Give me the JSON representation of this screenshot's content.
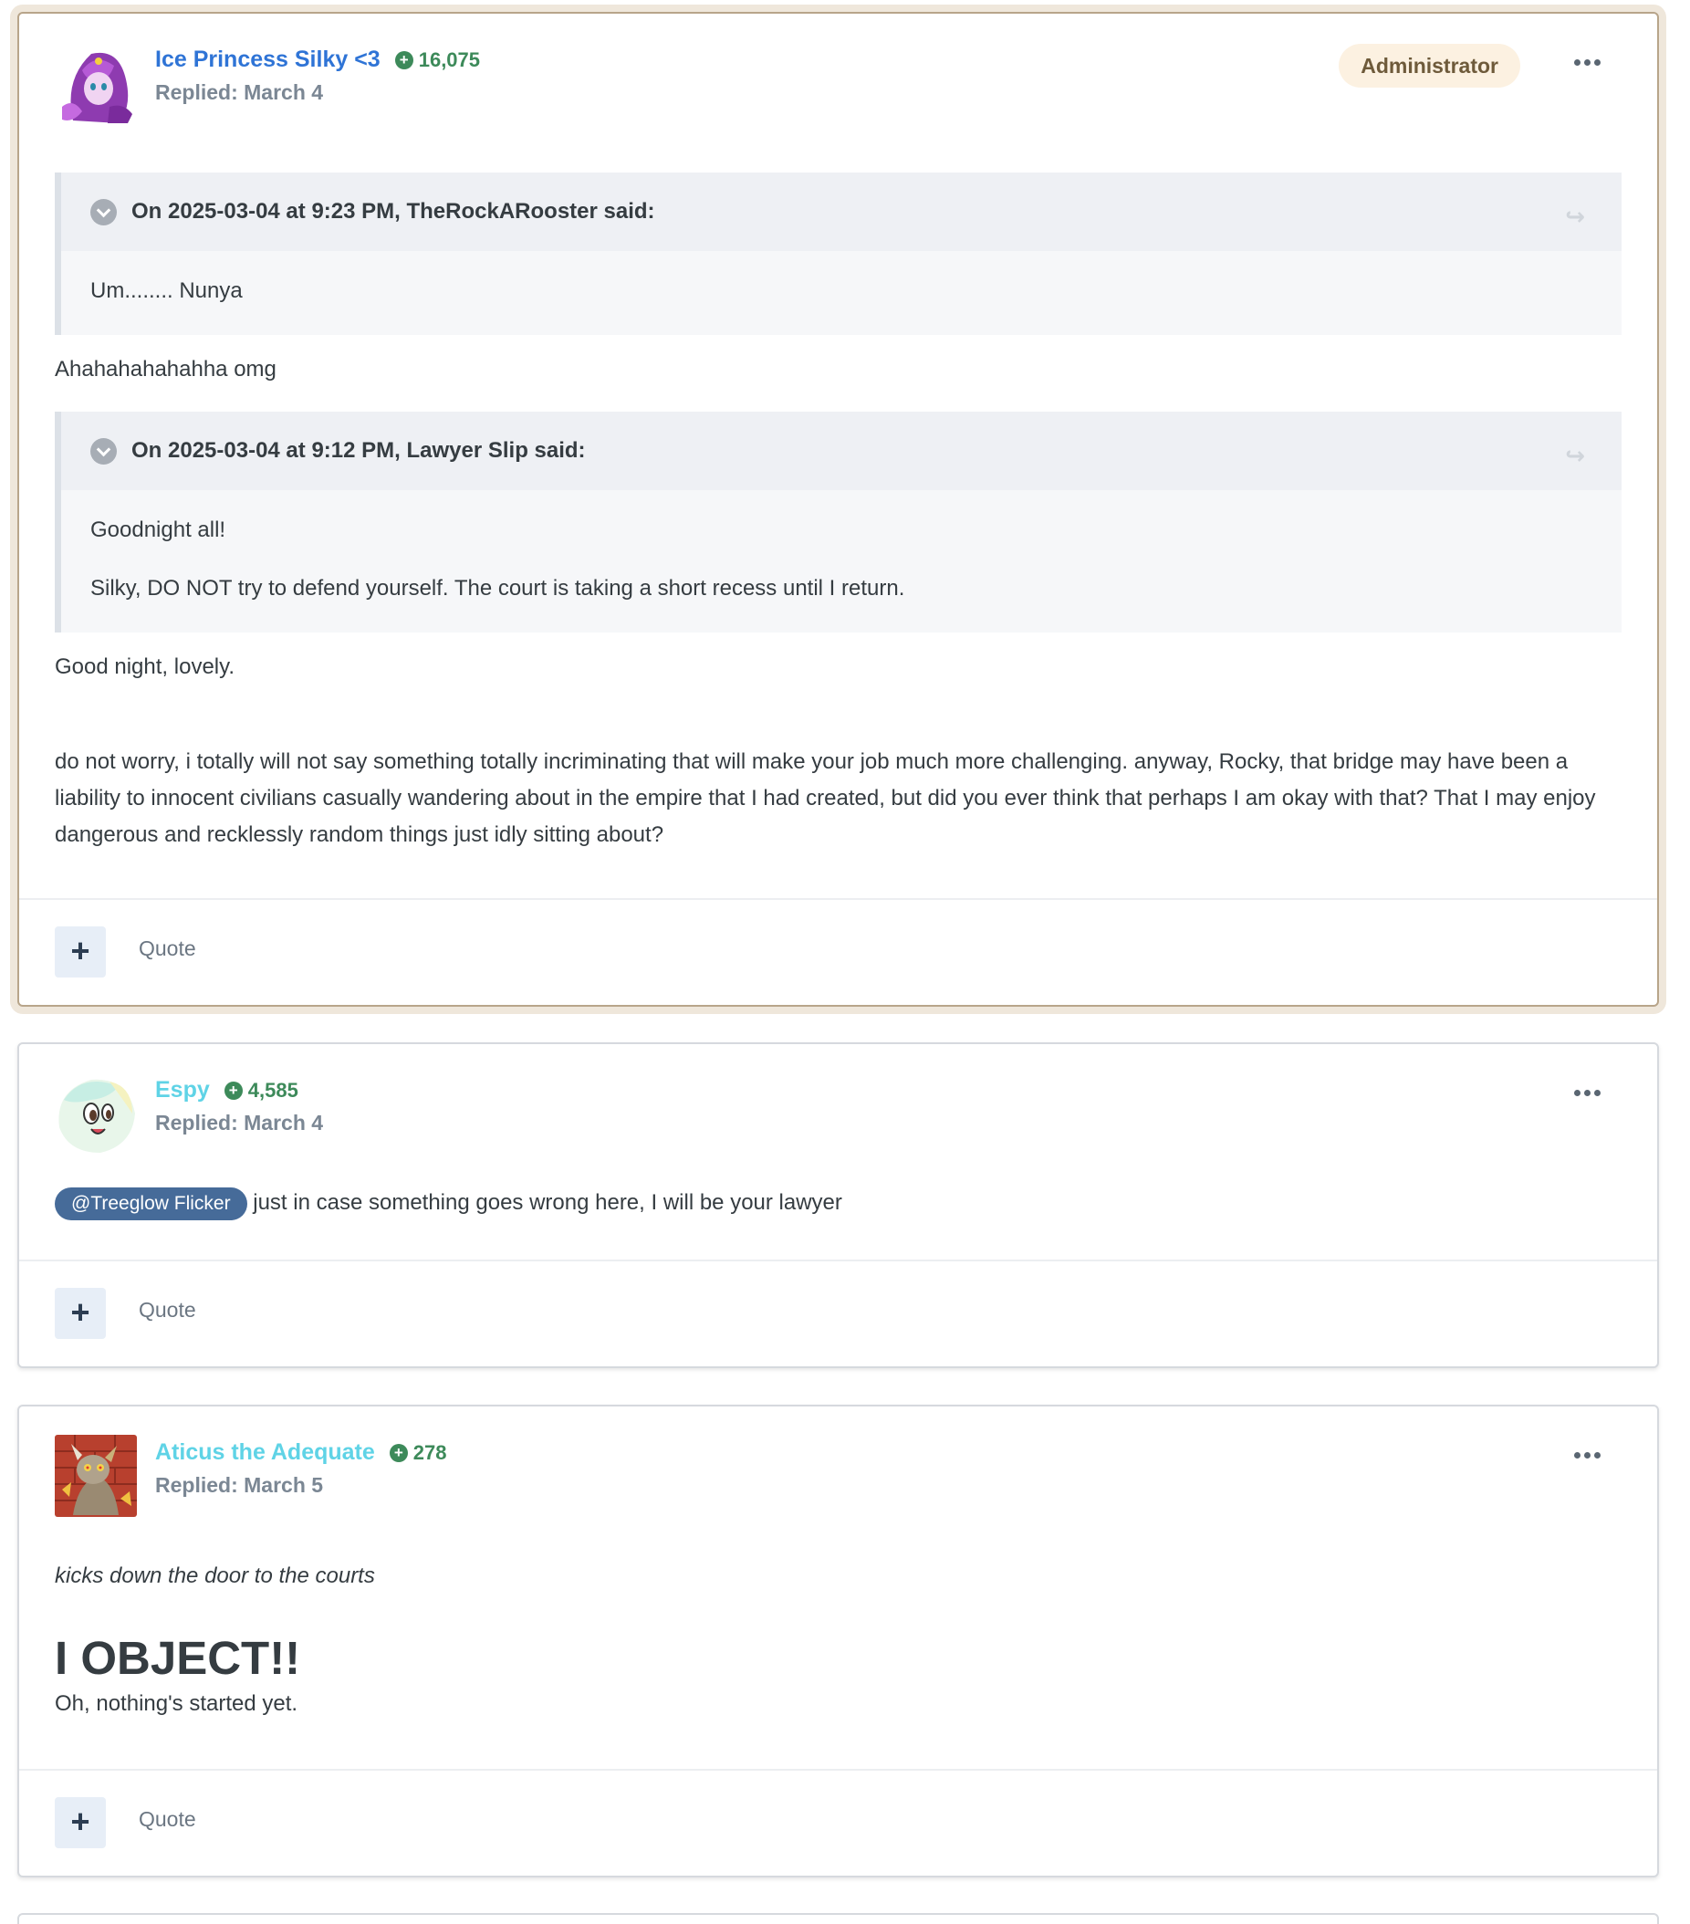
{
  "posts": [
    {
      "author": "Ice Princess Silky <3",
      "reputation": "16,075",
      "replied": "Replied: March 4",
      "badge": "Administrator",
      "quote1_header": "On 2025-03-04 at 9:23 PM, TheRockARooster said:",
      "quote1_body": "Um........ Nunya",
      "reply1": "Ahahahahahahha omg",
      "quote2_header": "On 2025-03-04 at 9:12 PM, Lawyer Slip said:",
      "quote2_body1": "Goodnight all!",
      "quote2_body2": "Silky, DO NOT try to defend yourself. The court is taking a short recess until I return.",
      "reply2": "Good night, lovely.",
      "reply3": "do not worry, i totally will not say something totally incriminating that will make your job much more challenging. anyway, Rocky, that bridge may have been a liability to innocent civilians casually wandering about in the empire that I had created, but did you ever think that perhaps I am okay with that? That I may enjoy dangerous and recklessly random things just idly sitting about?",
      "quote_label": "Quote"
    },
    {
      "author": "Espy",
      "reputation": "4,585",
      "replied": "Replied: March 4",
      "mention": "@Treeglow Flicker",
      "text": "just in case something goes wrong here, I will be your lawyer",
      "quote_label": "Quote"
    },
    {
      "author": "Aticus the Adequate",
      "reputation": "278",
      "replied": "Replied: March 5",
      "italic": "kicks down the door to the courts",
      "big": "I OBJECT!!",
      "text": "Oh, nothing's started yet.",
      "quote_label": "Quote"
    }
  ],
  "icons": {
    "plus": "+",
    "share": "↪",
    "reputation": "+"
  },
  "colors": {
    "author_blue": "#2f74d6",
    "author_cyan": "#5fd3e6",
    "reputation_green": "#3d8a5a",
    "mention_bg": "#466b99",
    "admin_badge_bg": "#fcf1e1"
  }
}
